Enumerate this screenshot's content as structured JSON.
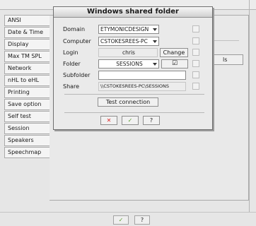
{
  "sidebar": {
    "items": [
      {
        "label": "ANSI"
      },
      {
        "label": "Date & Time"
      },
      {
        "label": "Display"
      },
      {
        "label": "Max TM SPL"
      },
      {
        "label": "Network"
      },
      {
        "label": "nHL to eHL"
      },
      {
        "label": "Printing"
      },
      {
        "label": "Save option"
      },
      {
        "label": "Self test"
      },
      {
        "label": "Session"
      },
      {
        "label": "Speakers"
      },
      {
        "label": "Speechmap"
      }
    ]
  },
  "background": {
    "button_label": "ls"
  },
  "dialog": {
    "title": "Windows shared folder",
    "domain": {
      "label": "Domain",
      "value": "ETYMONICDESIGN"
    },
    "computer": {
      "label": "Computer",
      "value": "CSTOKESREES-PC"
    },
    "login": {
      "label": "Login",
      "value": "chris",
      "change_label": "Change"
    },
    "folder": {
      "label": "Folder",
      "value": "SESSIONS",
      "check_label": "☑"
    },
    "subfolder": {
      "label": "Subfolder",
      "value": ""
    },
    "share": {
      "label": "Share",
      "value": "\\\\CSTOKESREES-PC\\SESSIONS"
    },
    "test_connection_label": "Test connection",
    "footer_buttons": {
      "cancel": "✕",
      "ok": "✓",
      "help": "?"
    }
  },
  "bottom_bar": {
    "ok": "✓",
    "help": "?"
  },
  "colors": {
    "cancel": "#d22",
    "ok": "#5a9e2f"
  }
}
